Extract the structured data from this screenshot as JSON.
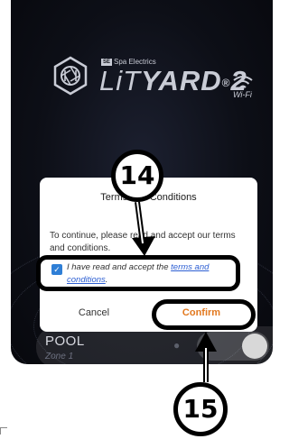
{
  "logo": {
    "brand": "Spa Electrics",
    "brand_badge": "SE",
    "name_part1": "LiT",
    "name_part2": "YARD",
    "name_sup": "®",
    "name_model": "2",
    "wifi_label": "Wi-Fi"
  },
  "pool": {
    "title": "POOL",
    "subtitle": "Zone 1",
    "light_on": true
  },
  "dialog": {
    "title": "Terms and Conditions",
    "body": "To continue, please read and accept our terms and conditions.",
    "agree_prefix": "I have read and accept the ",
    "agree_link": "terms and conditions",
    "agree_suffix": ".",
    "checked": true,
    "cancel_label": "Cancel",
    "confirm_label": "Confirm"
  },
  "annotations": {
    "step_1": "14",
    "step_2": "15"
  },
  "colors": {
    "accent": "#e2781e",
    "link": "#2d5fd3",
    "checkbox": "#2f7fd6",
    "background": "#0d0f17"
  }
}
